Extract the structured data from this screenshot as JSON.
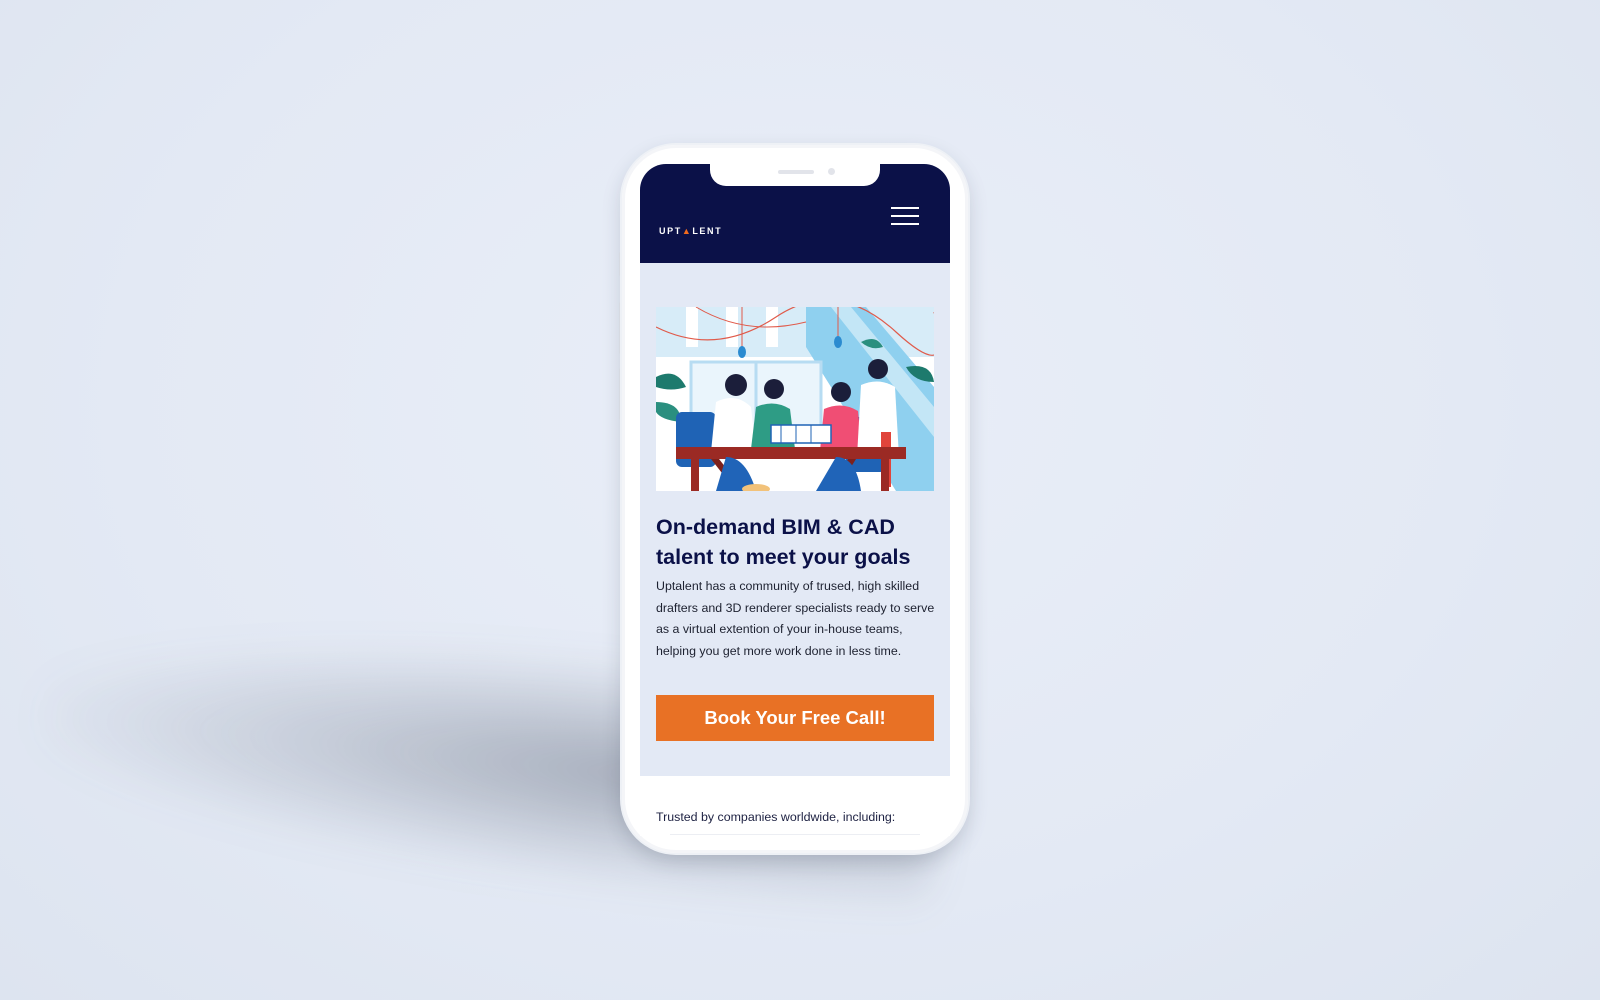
{
  "brand": {
    "logo_prefix": "UPT",
    "logo_accent": "▲",
    "logo_suffix": "LENT",
    "navy": "#0b1148",
    "orange": "#e87125"
  },
  "nav": {
    "menu_icon": "hamburger-menu-icon"
  },
  "hero": {
    "title": "On-demand BIM & CAD talent to meet your goals",
    "description": "Uptalent has a community of trused, high skilled drafters and 3D renderer specialists ready to serve as a virtual extention of your in-house teams, helping you get more work done in less time.",
    "cta_label": "Book Your Free Call!"
  },
  "trusted": {
    "label": "Trusted by companies worldwide, including:"
  }
}
